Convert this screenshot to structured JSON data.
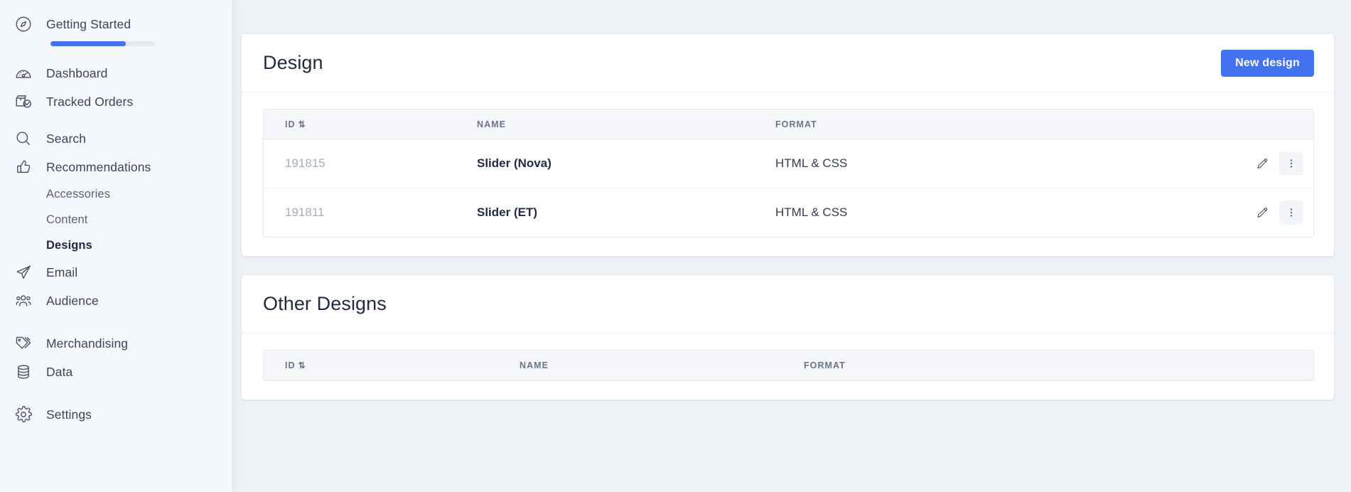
{
  "colors": {
    "accent": "#4272f0",
    "sidebar_bg": "#f4f7fb",
    "page_bg": "#eef1f6",
    "card_bg": "#ffffff",
    "table_header_bg": "#f4f6fa",
    "muted_text": "#a5adbe",
    "heading_text": "#202a42"
  },
  "sidebar": {
    "getting_started": {
      "label": "Getting Started",
      "icon": "compass-icon",
      "progress_percent": 72
    },
    "items": [
      {
        "label": "Dashboard",
        "icon": "gauge-icon",
        "type": "top",
        "active": false
      },
      {
        "label": "Tracked Orders",
        "icon": "package-check-icon",
        "type": "top",
        "active": false
      },
      {
        "label": "Search",
        "icon": "magnifier-icon",
        "type": "top",
        "active": false
      },
      {
        "label": "Recommendations",
        "icon": "thumbs-up-icon",
        "type": "top",
        "active": false
      },
      {
        "label": "Accessories",
        "icon": "",
        "type": "sub",
        "active": false
      },
      {
        "label": "Content",
        "icon": "",
        "type": "sub",
        "active": false
      },
      {
        "label": "Designs",
        "icon": "",
        "type": "sub",
        "active": true
      },
      {
        "label": "Email",
        "icon": "paper-plane-icon",
        "type": "top",
        "active": false
      },
      {
        "label": "Audience",
        "icon": "people-icon",
        "type": "top",
        "active": false
      },
      {
        "label": "Merchandising",
        "icon": "tags-icon",
        "type": "top",
        "active": false
      },
      {
        "label": "Data",
        "icon": "database-icon",
        "type": "top",
        "active": false
      },
      {
        "label": "Settings",
        "icon": "gear-icon",
        "type": "top",
        "active": false
      }
    ]
  },
  "design_card": {
    "title": "Design",
    "new_button": "New design",
    "columns": {
      "id": "ID",
      "name": "NAME",
      "format": "FORMAT",
      "sort_glyph": "⇅"
    },
    "rows": [
      {
        "id": "191815",
        "name": "Slider (Nova)",
        "format": "HTML & CSS",
        "edit_icon": "pencil-icon",
        "more_icon": "more-vertical-icon"
      },
      {
        "id": "191811",
        "name": "Slider (ET)",
        "format": "HTML & CSS",
        "edit_icon": "pencil-icon",
        "more_icon": "more-vertical-icon"
      }
    ]
  },
  "other_designs_card": {
    "title": "Other Designs",
    "columns": {
      "id": "ID",
      "name": "NAME",
      "format": "FORMAT",
      "sort_glyph": "⇅"
    },
    "rows": []
  }
}
